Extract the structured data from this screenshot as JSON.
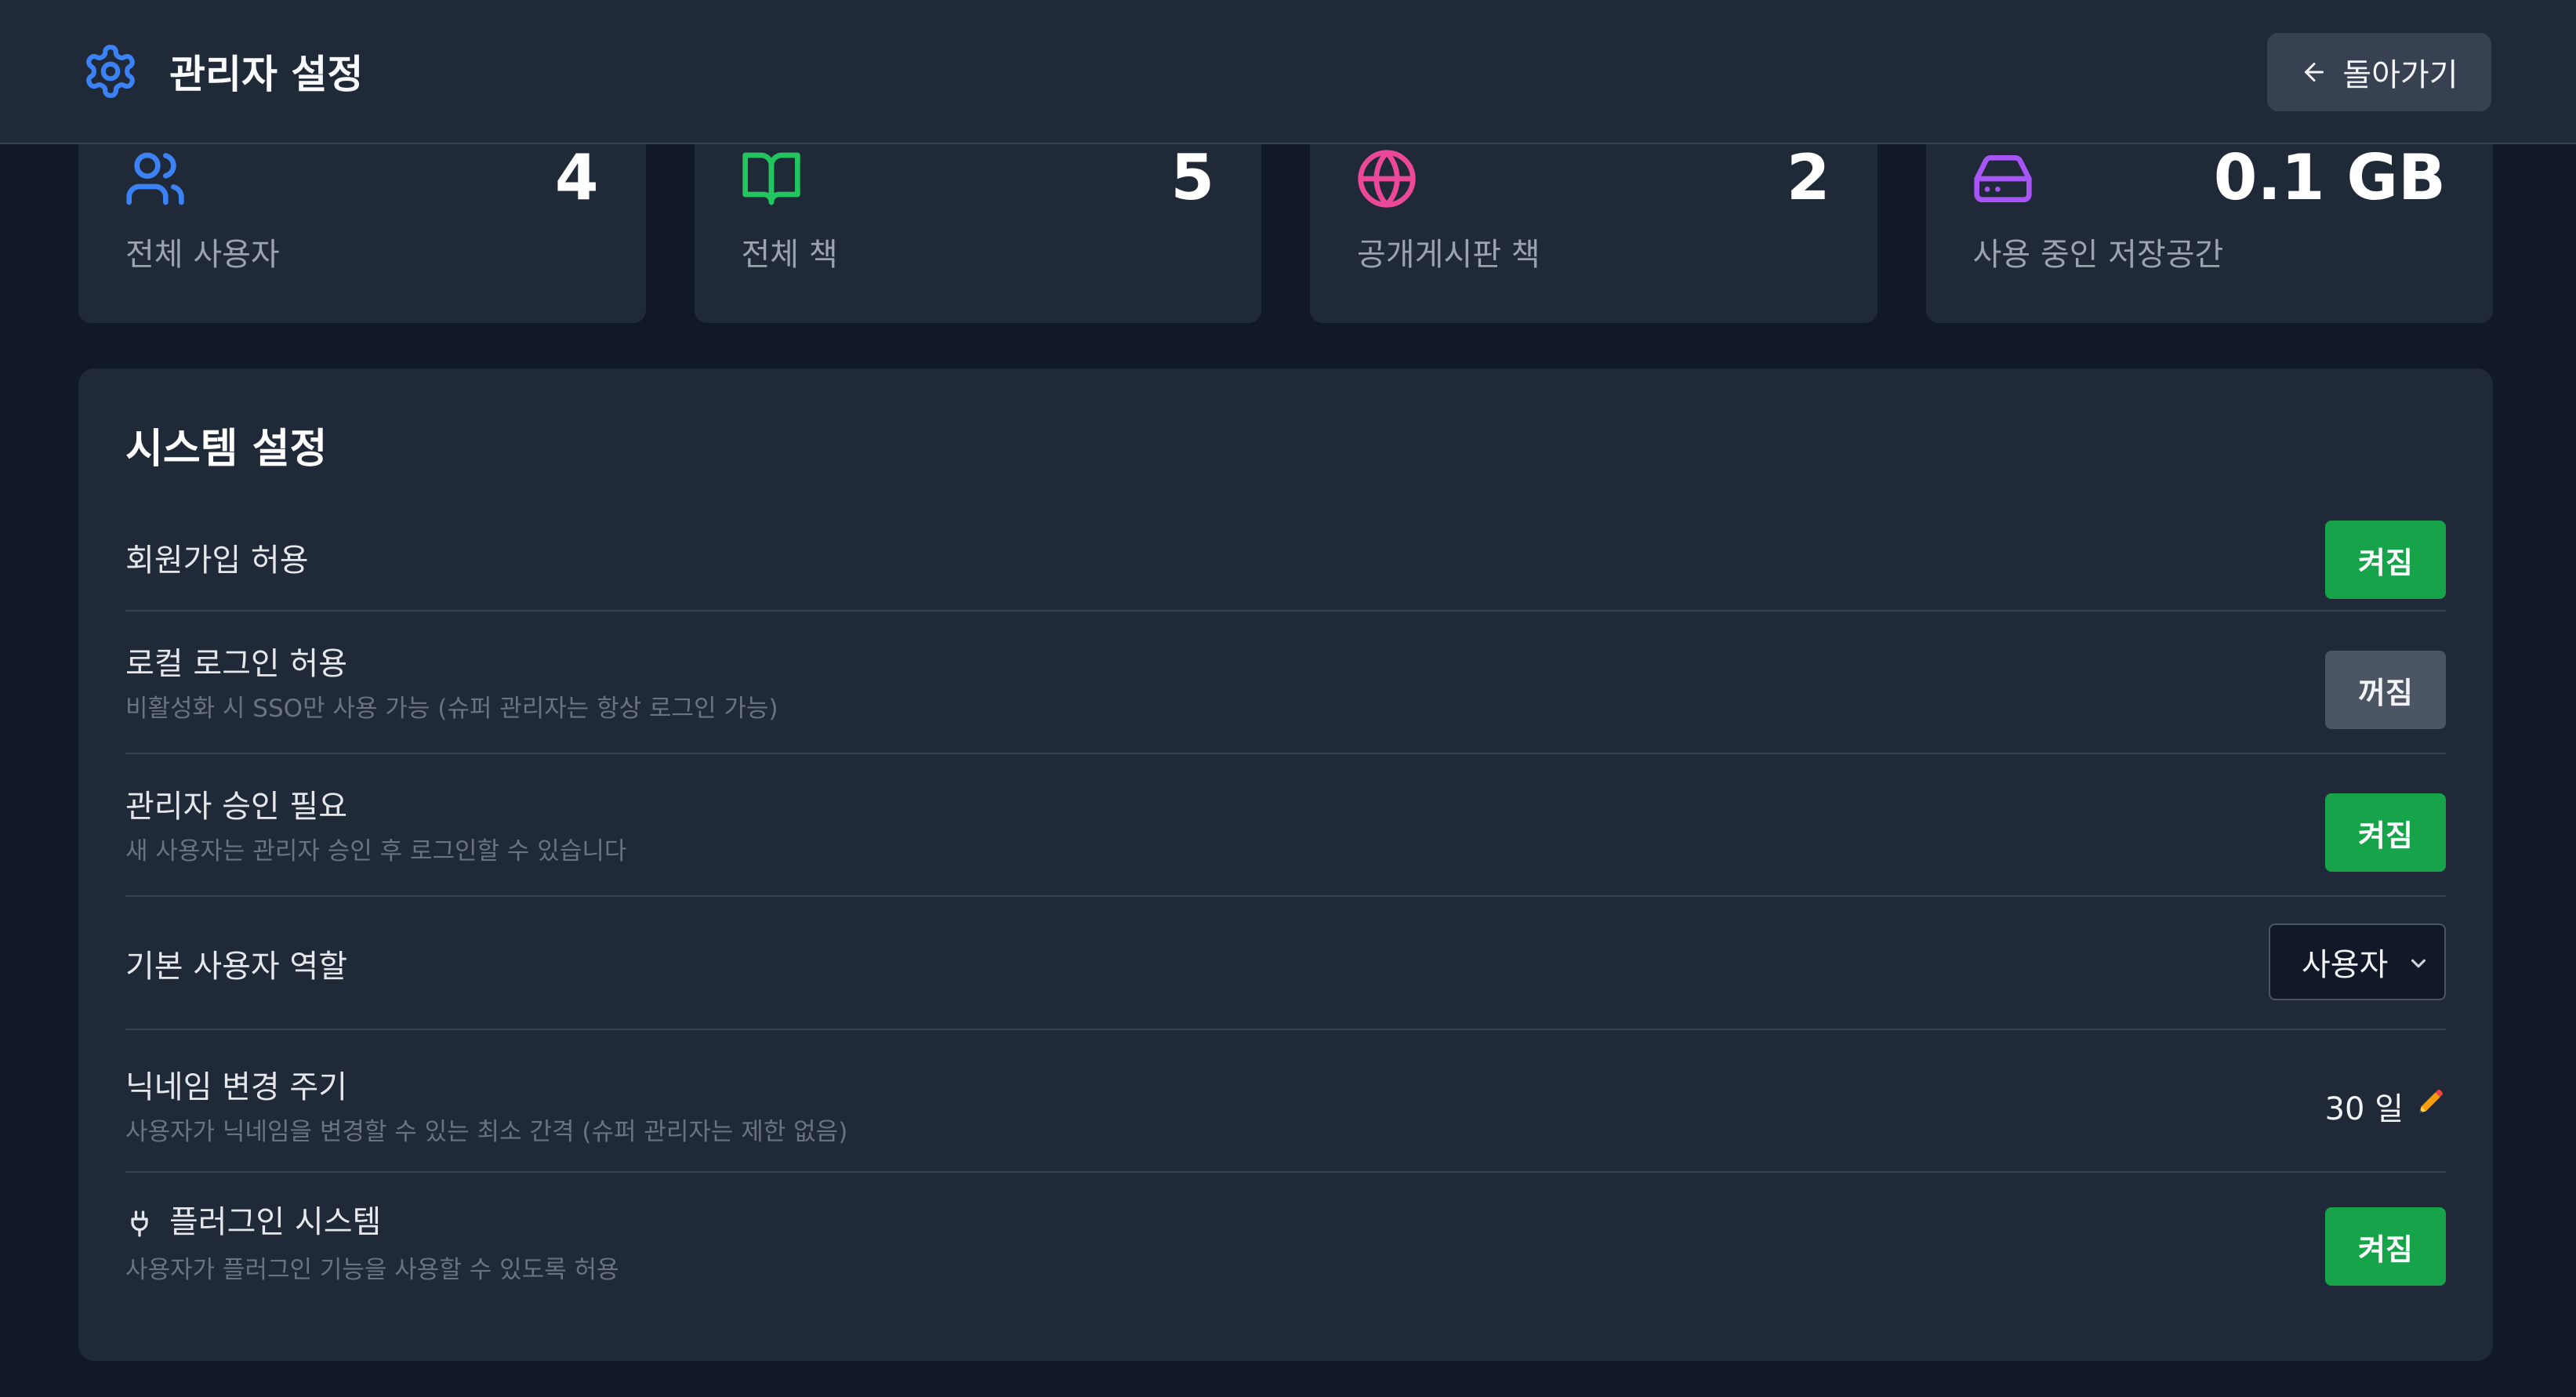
{
  "header": {
    "title": "관리자 설정",
    "back_label": "돌아가기"
  },
  "stats": [
    {
      "icon": "users-icon",
      "value": "4",
      "label": "전체 사용자",
      "color": "#3b82f6"
    },
    {
      "icon": "book-icon",
      "value": "5",
      "label": "전체 책",
      "color": "#22c55e"
    },
    {
      "icon": "globe-icon",
      "value": "2",
      "label": "공개게시판 책",
      "color": "#ec4899"
    },
    {
      "icon": "hard-drive-icon",
      "value": "0.1 GB",
      "label": "사용 중인 저장공간",
      "color": "#a855f7"
    }
  ],
  "system": {
    "title": "시스템 설정",
    "settings": [
      {
        "name": "회원가입 허용",
        "desc": "",
        "state": "켜짐"
      },
      {
        "name": "로컬 로그인 허용",
        "desc": "비활성화 시 SSO만 사용 가능 (슈퍼 관리자는 항상 로그인 가능)",
        "state": "꺼짐"
      },
      {
        "name": "관리자 승인 필요",
        "desc": "새 사용자는 관리자 승인 후 로그인할 수 있습니다",
        "state": "켜짐"
      },
      {
        "name": "기본 사용자 역할",
        "desc": "",
        "select_value": "사용자"
      },
      {
        "name": "닉네임 변경 주기",
        "desc": "사용자가 닉네임을 변경할 수 있는 최소 간격 (슈퍼 관리자는 제한 없음)",
        "value": "30 일"
      },
      {
        "name": "플러그인 시스템",
        "desc": "사용자가 플러그인 기능을 사용할 수 있도록 허용",
        "state": "켜짐"
      }
    ]
  },
  "colors": {
    "accent": "#3b82f6",
    "on": "#16a34a",
    "off": "#4b5563",
    "background": "#111827",
    "card": "#1f2937"
  }
}
